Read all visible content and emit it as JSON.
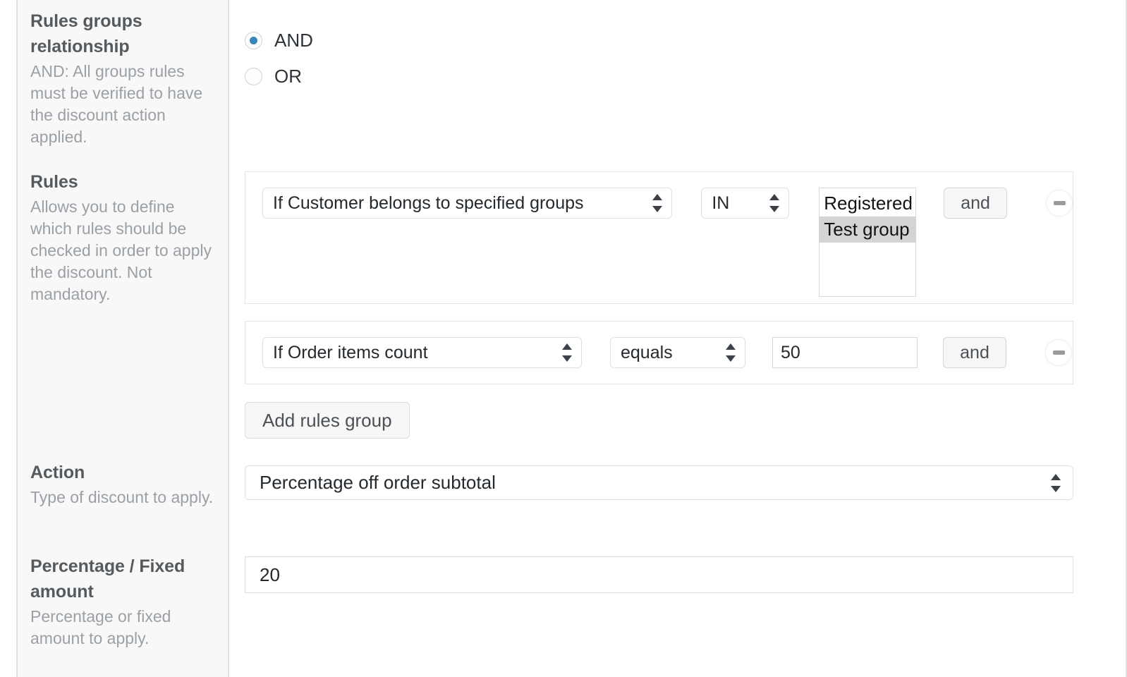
{
  "sidebar": {
    "sections": [
      {
        "title": "Rules groups relationship",
        "description": "AND: All groups rules must be verified to have the discount action applied."
      },
      {
        "title": "Rules",
        "description": "Allows you to define which rules should be checked in order to apply the discount. Not mandatory."
      },
      {
        "title": "Action",
        "description": "Type of discount to apply."
      },
      {
        "title": "Percentage / Fixed amount",
        "description": "Percentage or fixed amount to apply."
      }
    ]
  },
  "relationship": {
    "selected": "AND",
    "options": [
      {
        "label": "AND",
        "checked": true
      },
      {
        "label": "OR",
        "checked": false
      }
    ]
  },
  "rule_groups": [
    {
      "condition": "If Customer belongs to specified groups",
      "operator": "IN",
      "value_list": [
        {
          "label": "Registered",
          "selected": false
        },
        {
          "label": "Test group",
          "selected": true
        }
      ],
      "join_button": "and",
      "remove_icon": "minus-circle-icon"
    },
    {
      "condition": "If Order items count",
      "operator": "equals",
      "value": "50",
      "join_button": "and",
      "remove_icon": "minus-circle-icon"
    }
  ],
  "buttons": {
    "add_rules_group": "Add rules group"
  },
  "action": {
    "selected": "Percentage off order subtotal"
  },
  "amount": {
    "value": "20"
  },
  "colors": {
    "radio_accent": "#3a85b9",
    "sidebar_bg": "#f8f8f8",
    "text_muted": "#9aa0a6",
    "text_heading": "#555a5e",
    "selected_option_bg": "#d4d4d4"
  }
}
